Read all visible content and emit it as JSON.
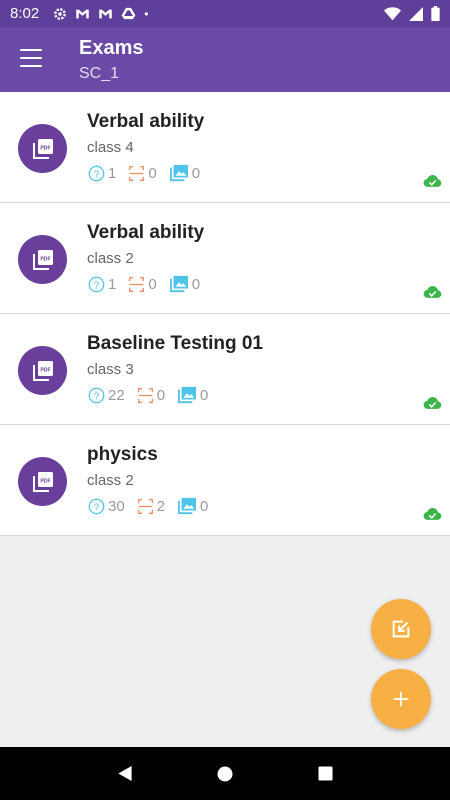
{
  "status_bar": {
    "time": "8:02",
    "left_icons": [
      "gear-icon",
      "gmail-icon",
      "gmail-icon",
      "drive-icon",
      "dot-icon"
    ],
    "right_icons": [
      "wifi-icon",
      "signal-icon",
      "battery-icon"
    ]
  },
  "app_bar": {
    "title": "Exams",
    "subtitle": "SC_1"
  },
  "exams": [
    {
      "title": "Verbal ability",
      "class": "class 4",
      "questions": "1",
      "scans": "0",
      "images": "0",
      "synced": true
    },
    {
      "title": "Verbal ability",
      "class": "class 2",
      "questions": "1",
      "scans": "0",
      "images": "0",
      "synced": true
    },
    {
      "title": "Baseline Testing 01",
      "class": "class 3",
      "questions": "22",
      "scans": "0",
      "images": "0",
      "synced": true
    },
    {
      "title": "physics",
      "class": "class 2",
      "questions": "30",
      "scans": "2",
      "images": "0",
      "synced": true
    }
  ],
  "colors": {
    "app_bar": "#6a4aa6",
    "status_bar": "#5e3f9a",
    "avatar": "#6a3f9c",
    "fab": "#f8b045",
    "question_icon": "#4fc3e8",
    "scan_icon": "#f08a5d",
    "image_icon": "#4fc3e8",
    "cloud_ok": "#3cb54a"
  },
  "fabs": [
    "import-icon",
    "plus-icon"
  ],
  "nav": [
    "back-icon",
    "home-icon",
    "recents-icon"
  ]
}
